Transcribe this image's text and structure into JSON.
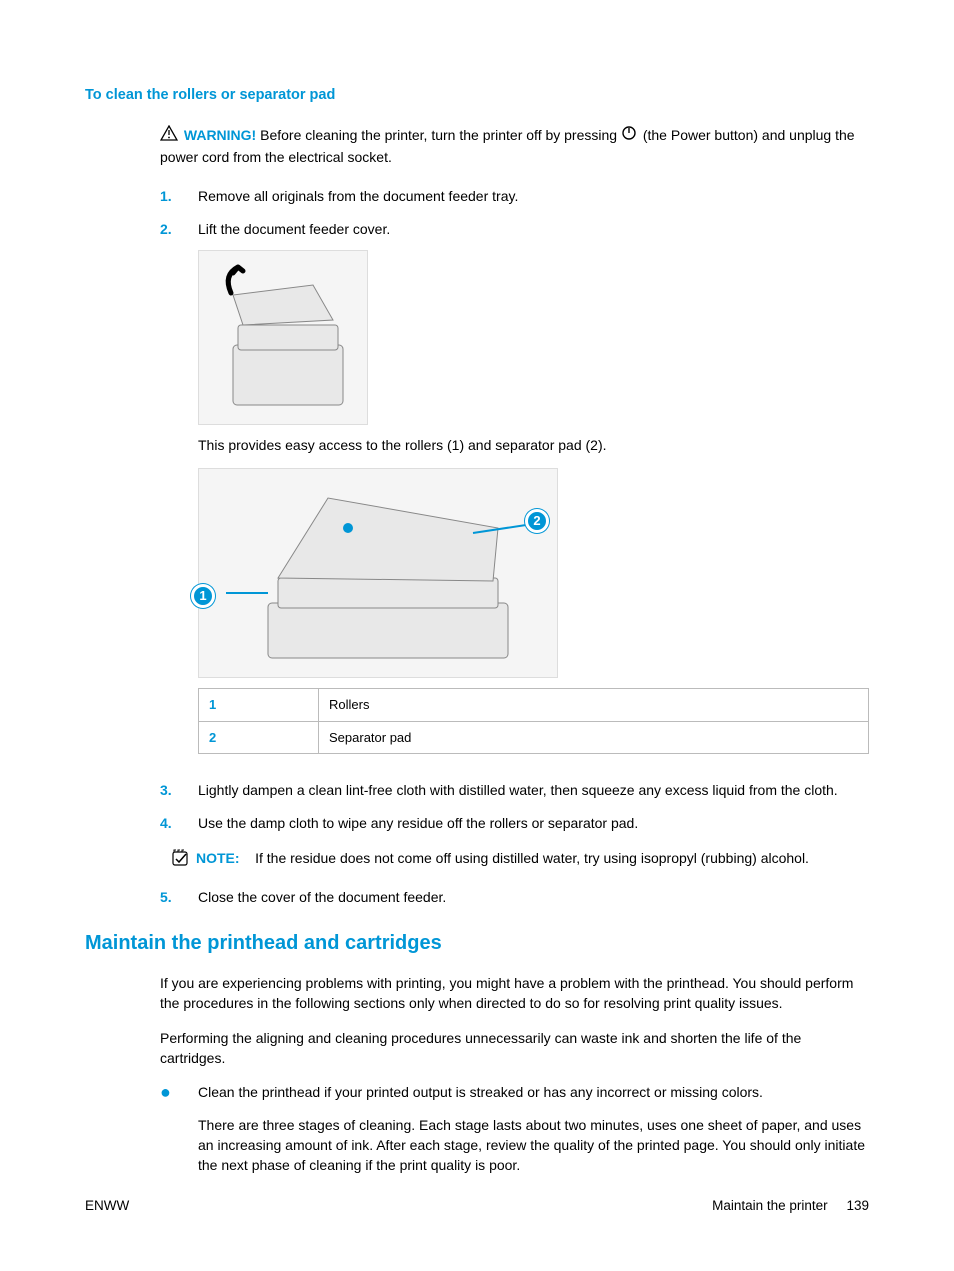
{
  "heading1": "To clean the rollers or separator pad",
  "warning": {
    "label": "WARNING!",
    "text_before": "Before cleaning the printer, turn the printer off by pressing ",
    "text_after": " (the Power button) and unplug the power cord from the electrical socket."
  },
  "steps": {
    "s1": {
      "num": "1.",
      "text": "Remove all originals from the document feeder tray."
    },
    "s2": {
      "num": "2.",
      "text": "Lift the document feeder cover.",
      "caption": "This provides easy access to the rollers (1) and separator pad (2)."
    },
    "s3": {
      "num": "3.",
      "text": "Lightly dampen a clean lint-free cloth with distilled water, then squeeze any excess liquid from the cloth."
    },
    "s4": {
      "num": "4.",
      "text": "Use the damp cloth to wipe any residue off the rollers or separator pad.",
      "note_label": "NOTE:",
      "note_text": "If the residue does not come off using distilled water, try using isopropyl (rubbing) alcohol."
    },
    "s5": {
      "num": "5.",
      "text": "Close the cover of the document feeder."
    }
  },
  "parts_table": {
    "r1": {
      "num": "1",
      "label": "Rollers"
    },
    "r2": {
      "num": "2",
      "label": "Separator pad"
    }
  },
  "heading2": "Maintain the printhead and cartridges",
  "maintain": {
    "p1": "If you are experiencing problems with printing, you might have a problem with the printhead. You should perform the procedures in the following sections only when directed to do so for resolving print quality issues.",
    "p2": "Performing the aligning and cleaning procedures unnecessarily can waste ink and shorten the life of the cartridges.",
    "b1": "Clean the printhead if your printed output is streaked or has any incorrect or missing colors.",
    "b1p2": "There are three stages of cleaning. Each stage lasts about two minutes, uses one sheet of paper, and uses an increasing amount of ink. After each stage, review the quality of the printed page. You should only initiate the next phase of cleaning if the print quality is poor."
  },
  "markers": {
    "m1": "1",
    "m2": "2"
  },
  "footer": {
    "left": "ENWW",
    "right_section": "Maintain the printer",
    "page": "139"
  }
}
